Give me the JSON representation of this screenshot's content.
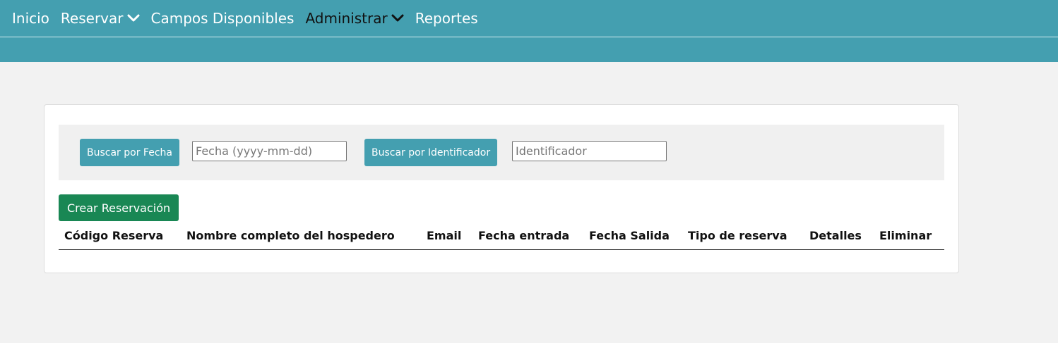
{
  "nav": {
    "items": [
      {
        "label": "Inicio",
        "dropdown": false
      },
      {
        "label": "Reservar",
        "dropdown": true
      },
      {
        "label": "Campos Disponibles",
        "dropdown": false
      },
      {
        "label": "Administrar",
        "dropdown": true,
        "active": true
      },
      {
        "label": "Reportes",
        "dropdown": false
      }
    ]
  },
  "search": {
    "by_date_label": "Buscar por Fecha",
    "date_placeholder": "Fecha (yyyy-mm-dd)",
    "date_value": "",
    "by_id_label": "Buscar por Identificador",
    "id_placeholder": "Identificador",
    "id_value": ""
  },
  "actions": {
    "create_label": "Crear Reservación"
  },
  "table": {
    "columns": [
      "Código Reserva",
      "Nombre completo del hospedero",
      "Email",
      "Fecha entrada",
      "Fecha Salida",
      "Tipo de reserva",
      "Detalles",
      "Eliminar"
    ],
    "rows": []
  },
  "colors": {
    "header_bg": "#449fb0",
    "page_bg": "#f2f2f2",
    "search_button": "#449fb0",
    "create_button": "#198754",
    "active_nav_text": "#111111"
  },
  "icons": {
    "dropdown": "chevron-down-icon"
  }
}
